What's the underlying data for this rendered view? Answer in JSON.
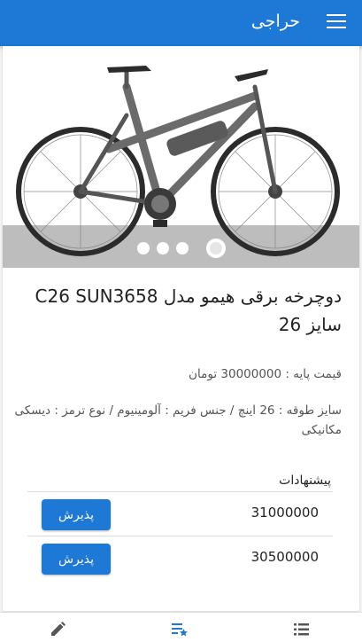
{
  "appbar": {
    "title": "حراجی",
    "menu_icon": "hamburger-menu-icon",
    "color": "#1e78d6"
  },
  "product": {
    "image_icon": "electric-bicycle-image",
    "carousel_slides": 4,
    "carousel_active": 4,
    "title": "دوچرخه برقی هیمو مدل C26 SUN3658 سایز 26",
    "price": "قیمت پایه : 30000000 تومان",
    "specs": "سایز طوقه : 26 اینچ / جنس فریم : آلومینیوم / نوع ترمز : دیسکی مکانیکی"
  },
  "offers": {
    "heading": "پیشنهادات",
    "accept_label": "پذیرش",
    "items": [
      {
        "amount": "31000000"
      },
      {
        "amount": "30500000"
      }
    ]
  },
  "bottom_nav": {
    "items": [
      {
        "icon": "pencil-icon"
      },
      {
        "icon": "starred-list-icon"
      },
      {
        "icon": "list-icon"
      }
    ]
  }
}
